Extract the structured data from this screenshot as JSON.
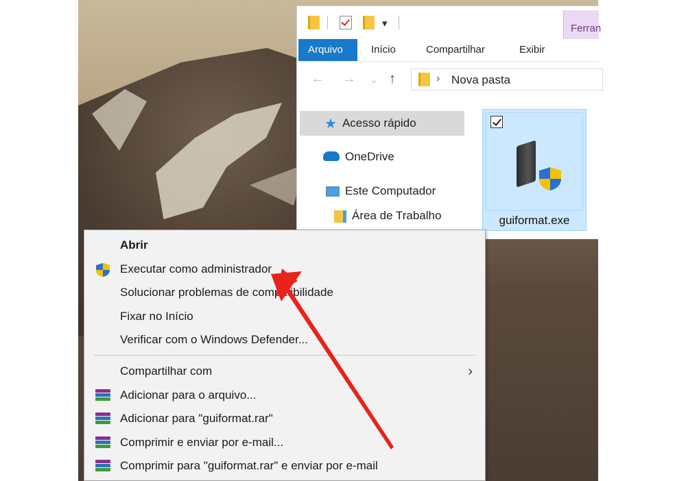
{
  "explorer": {
    "ribbon_context_tab": "Ferran",
    "tabs": [
      {
        "label": "Arquivo",
        "active": true
      },
      {
        "label": "Início",
        "active": false
      },
      {
        "label": "Compartilhar",
        "active": false
      },
      {
        "label": "Exibir",
        "active": false
      }
    ],
    "address": {
      "path": "Nova pasta"
    },
    "nav_pane": [
      {
        "label": "Acesso rápido",
        "icon": "star-icon",
        "selected": true
      },
      {
        "label": "OneDrive",
        "icon": "cloud-icon"
      },
      {
        "label": "Este Computador",
        "icon": "computer-icon"
      },
      {
        "label": "Área de Trabalho",
        "icon": "desktop-folder-icon"
      }
    ],
    "file": {
      "name": "guiformat.exe",
      "checked": true
    }
  },
  "context_menu": {
    "items": [
      {
        "label": "Abrir",
        "bold": true
      },
      {
        "label": "Executar como administrador",
        "icon": "uac-shield-icon"
      },
      {
        "label": "Solucionar problemas de compatibilidade"
      },
      {
        "label": "Fixar no Início"
      },
      {
        "label": "Verificar com o Windows Defender..."
      }
    ],
    "items2": [
      {
        "label": "Compartilhar com",
        "submenu": true
      },
      {
        "label": "Adicionar para o arquivo...",
        "icon": "winrar-icon"
      },
      {
        "label": "Adicionar para \"guiformat.rar\"",
        "icon": "winrar-icon"
      },
      {
        "label": "Comprimir e enviar por e-mail...",
        "icon": "winrar-icon"
      },
      {
        "label": "Comprimir para \"guiformat.rar\" e enviar por e-mail",
        "icon": "winrar-icon"
      }
    ]
  },
  "colors": {
    "accent": "#1979ca",
    "arrow": "#e8231b",
    "selection": "#cce8ff"
  }
}
